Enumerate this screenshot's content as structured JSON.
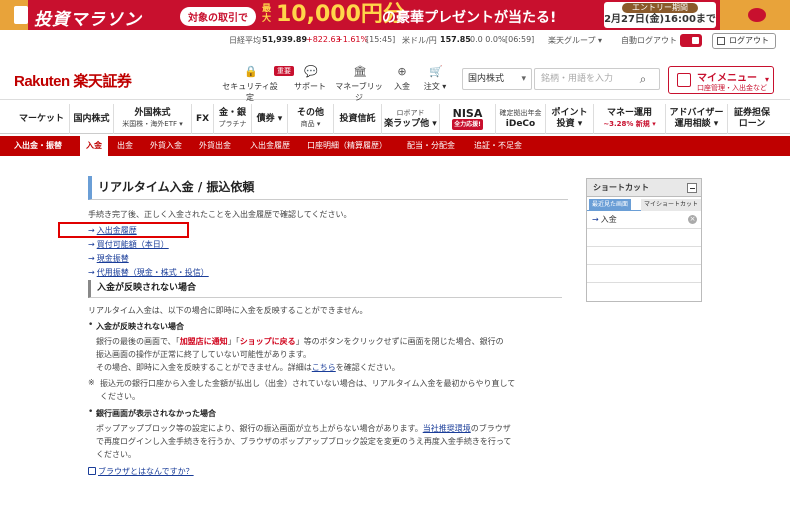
{
  "banner": {
    "title": "投資マラソン",
    "pill": "対象の取引で",
    "max_label": "最大",
    "amount": "10,000円分",
    "text": "の豪華プレゼントが当たる!",
    "entry_label": "エントリー期間",
    "entry_date": "2月27日(金)16:00まで"
  },
  "market": {
    "nikkei_label": "日経平均",
    "nikkei_value": "51,939.89",
    "nikkei_change": "+822.63",
    "nikkei_pct": "+1.61%",
    "nikkei_time": "[15:45]",
    "usd_label": "米ドル/円",
    "usd_value": "157.85",
    "usd_change": "0.0 0.0%",
    "usd_time": "[06:59]",
    "group": "楽天グループ ▾",
    "autologout": "自動ログアウト",
    "logout": "ログアウト"
  },
  "header": {
    "logo": "Rakuten 楽天証券",
    "badge": "重要",
    "security": "セキュリティ設定",
    "support": "サポート",
    "bridge": "マネーブリッジ",
    "deposit": "入金",
    "order": "注文 ▾",
    "select": "国内株式",
    "search_placeholder": "銘柄・用語を入力",
    "mymenu_title": "マイメニュー",
    "mymenu_sub": "口座管理・入出金など"
  },
  "gnav": [
    {
      "label": "マーケット",
      "sub": ""
    },
    {
      "label": "国内株式",
      "sub": ""
    },
    {
      "label": "外国株式",
      "sub": "米国株・海外ETF ▾"
    },
    {
      "label": "FX",
      "sub": ""
    },
    {
      "label": "金・銀",
      "sub": "プラチナ"
    },
    {
      "label": "債券 ▾",
      "sub": ""
    },
    {
      "label": "その他",
      "sub": "商品 ▾"
    },
    {
      "label": "投資信託",
      "sub": ""
    },
    {
      "label": "ロボアド",
      "sub": "楽ラップ他 ▾"
    },
    {
      "label": "NISA",
      "sub": "全力応援!"
    },
    {
      "label": "確定拠出年金",
      "sub": "iDeCo"
    },
    {
      "label": "ポイント",
      "sub": "投資 ▾"
    },
    {
      "label": "マネー運用",
      "sub": "~3.28% 新規 ▾"
    },
    {
      "label": "アドバイザー",
      "sub": "運用相談 ▾"
    },
    {
      "label": "証券担保",
      "sub": "ローン"
    }
  ],
  "subnav": {
    "head": "入出金・振替",
    "items": [
      "入金",
      "出金",
      "外貨入金",
      "外貨出金",
      "入出金履歴",
      "口座明細（精算履歴）",
      "配当・分配金",
      "追証・不足金"
    ]
  },
  "page": {
    "title": "リアルタイム入金 / 振込依頼",
    "intro": "手続き完了後、正しく入金されたことを入出金履歴で確認してください。",
    "links": [
      "入出金履歴",
      "買付可能額（本日）",
      "現金振替",
      "代用振替（現金・株式・投信）"
    ],
    "section": "入金が反映されない場合",
    "section_intro": "リアルタイム入金は、以下の場合に即時に入金を反映することができません。",
    "case1_title": "入金が反映されない場合",
    "case1_l1a": "銀行の最後の画面で、「",
    "case1_btn1": "加盟店に通知",
    "case1_mid": "」「",
    "case1_btn2": "ショップに戻る",
    "case1_l1b": "」等のボタンをクリックせずに画面を閉じた場合、銀行の",
    "case1_l2": "振込画面の操作が正常に終了していない可能性があります。",
    "case1_l3a": "その場合、即時に入金を反映することができません。詳細は",
    "case1_link": "こちら",
    "case1_l3b": "を確認ください。",
    "note_mark": "※",
    "note_l1": "振込元の銀行口座から入金した金額が払出し（出金）されていない場合は、リアルタイム入金を最初からやり直して",
    "note_l2": "ください。",
    "case2_title": "銀行画面が表示されなかった場合",
    "case2_l1a": "ポップアップブロック等の設定により、銀行の振込画面が立ち上がらない場合があります。",
    "case2_link": "当社推奨環境",
    "case2_l1b": "のブラウザ",
    "case2_l2": "で再度ログインし入金手続きを行うか、ブラウザのポップアップブロック設定を変更のうえ再度入金手続きを行って",
    "case2_l3": "ください。",
    "browser_link": "ブラウザとはなんですか？"
  },
  "shortcut": {
    "title": "ショートカット",
    "tab_recent": "最近見た画面",
    "tab_my": "マイショートカット",
    "item": "入金"
  }
}
